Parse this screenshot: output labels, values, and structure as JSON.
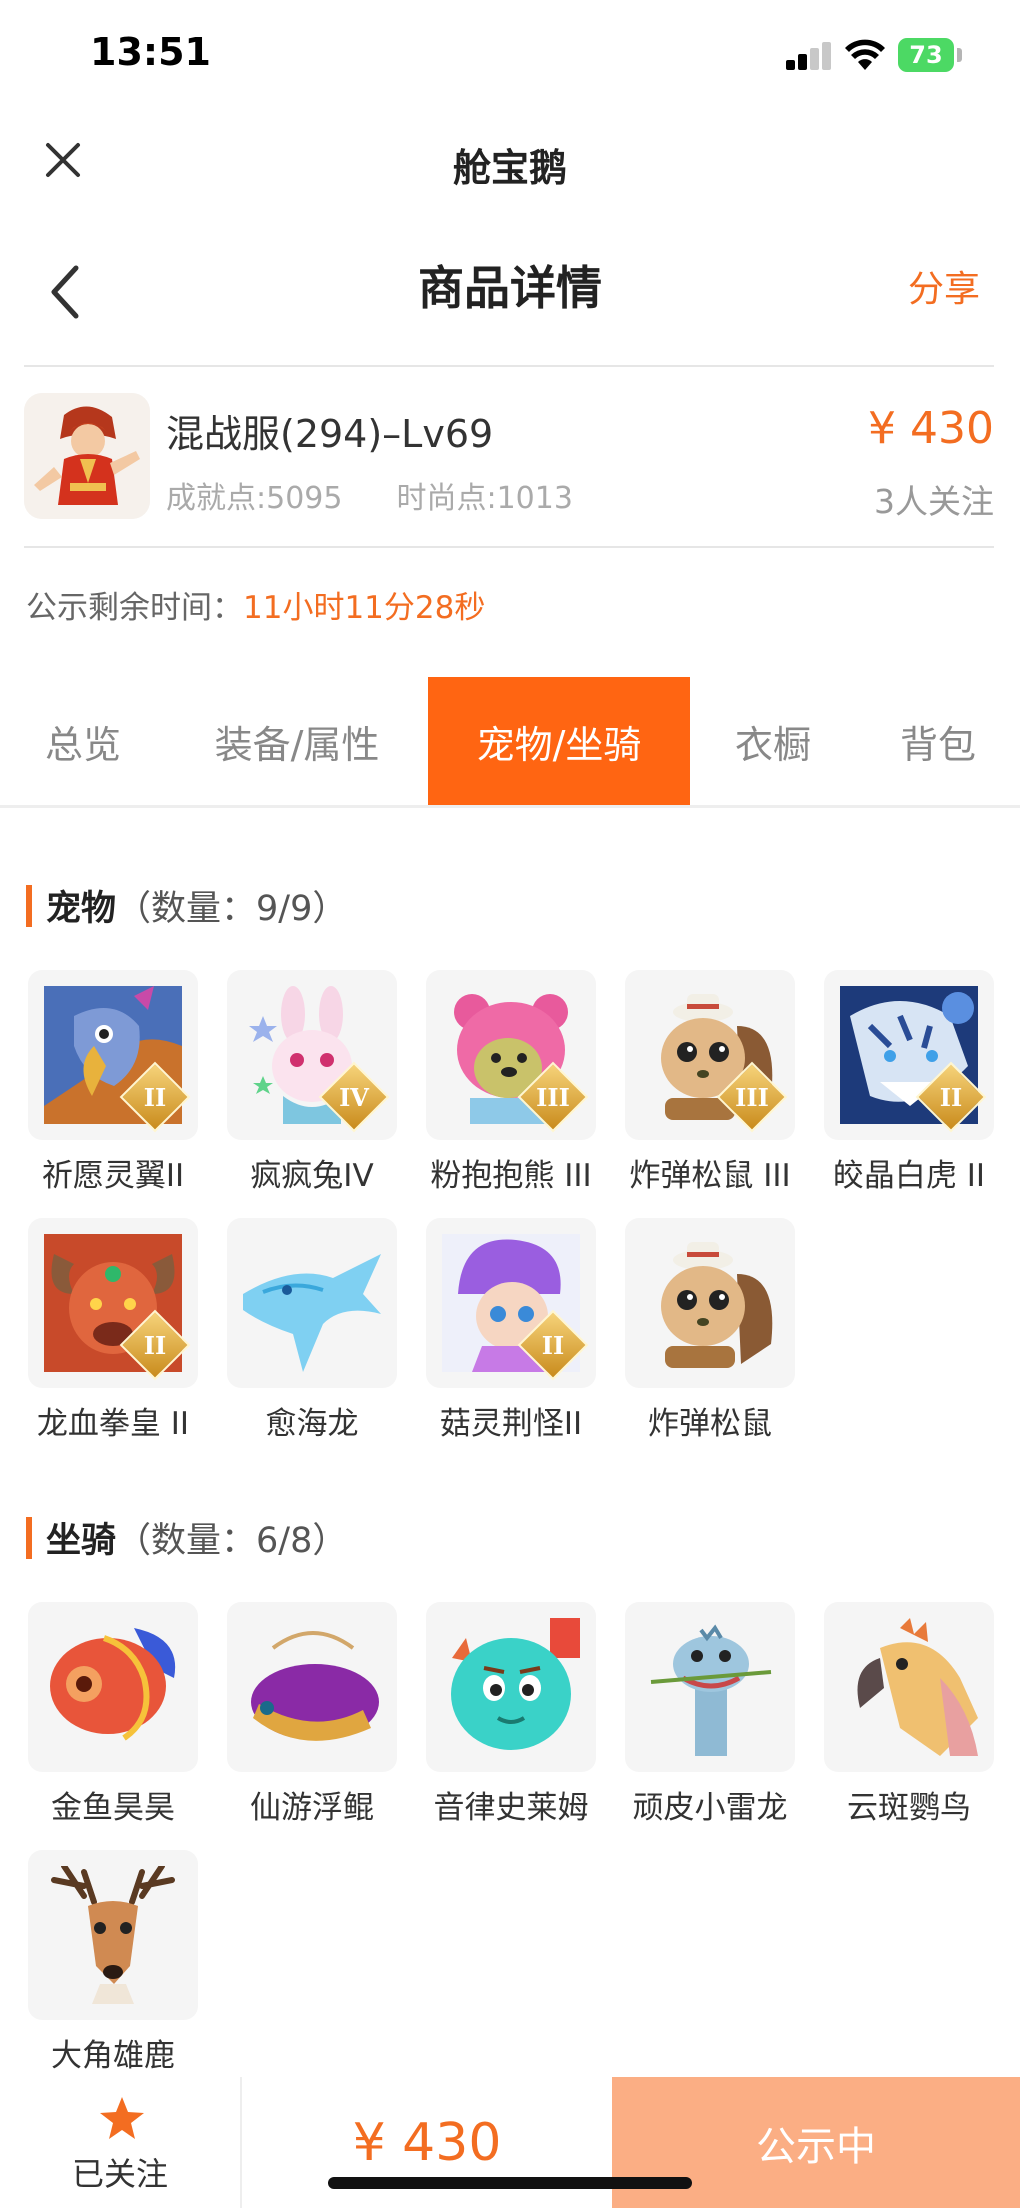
{
  "status_bar": {
    "time": "13:51",
    "battery": "73"
  },
  "app": {
    "title": "舱宝鹅"
  },
  "nav": {
    "title": "商品详情",
    "share": "分享"
  },
  "product": {
    "name": "混战服(294)–Lv69",
    "achievement": "成就点:5095",
    "fashion": "时尚点:1013",
    "price": "¥ 430",
    "followers": "3人关注"
  },
  "countdown": {
    "label": "公示剩余时间：",
    "value": "11小时11分28秒"
  },
  "tabs": [
    "总览",
    "装备/属性",
    "宠物/坐骑",
    "衣橱",
    "背包"
  ],
  "active_tab": "宠物/坐骑",
  "pets": {
    "title": "宠物",
    "count": "（数量：9/9）",
    "items": [
      {
        "label": "祈愿灵翼II",
        "rank": "II",
        "icon": "eagle-pet-icon"
      },
      {
        "label": "疯疯兔IV",
        "rank": "IV",
        "icon": "rabbit-pet-icon"
      },
      {
        "label": "粉抱抱熊 III",
        "rank": "III",
        "icon": "bear-pet-icon"
      },
      {
        "label": "炸弹松鼠 III",
        "rank": "III",
        "icon": "squirrel-pet-icon"
      },
      {
        "label": "皎晶白虎 II",
        "rank": "II",
        "icon": "tiger-pet-icon"
      },
      {
        "label": "龙血拳皇 II",
        "rank": "II",
        "icon": "dragon-boxer-pet-icon"
      },
      {
        "label": "愈海龙",
        "rank": "",
        "icon": "sea-dragon-pet-icon"
      },
      {
        "label": "菇灵荆怪II",
        "rank": "II",
        "icon": "mushroom-pet-icon"
      },
      {
        "label": "炸弹松鼠",
        "rank": "",
        "icon": "squirrel-pet-icon"
      }
    ]
  },
  "mounts": {
    "title": "坐骑",
    "count": "（数量：6/8）",
    "items": [
      {
        "label": "金鱼昊昊",
        "icon": "goldfish-mount-icon"
      },
      {
        "label": "仙游浮鲲",
        "icon": "flying-fish-mount-icon"
      },
      {
        "label": "音律史莱姆",
        "icon": "slime-mount-icon"
      },
      {
        "label": "顽皮小雷龙",
        "icon": "dinosaur-mount-icon"
      },
      {
        "label": "云斑鹦鸟",
        "icon": "parrot-mount-icon"
      },
      {
        "label": "大角雄鹿",
        "icon": "deer-mount-icon"
      }
    ]
  },
  "bottom": {
    "follow": "已关注",
    "price": "¥ 430",
    "status": "公示中"
  },
  "colors": {
    "accent": "#f36d21",
    "active_tab": "#ff6512",
    "status_button": "#fbae84"
  }
}
